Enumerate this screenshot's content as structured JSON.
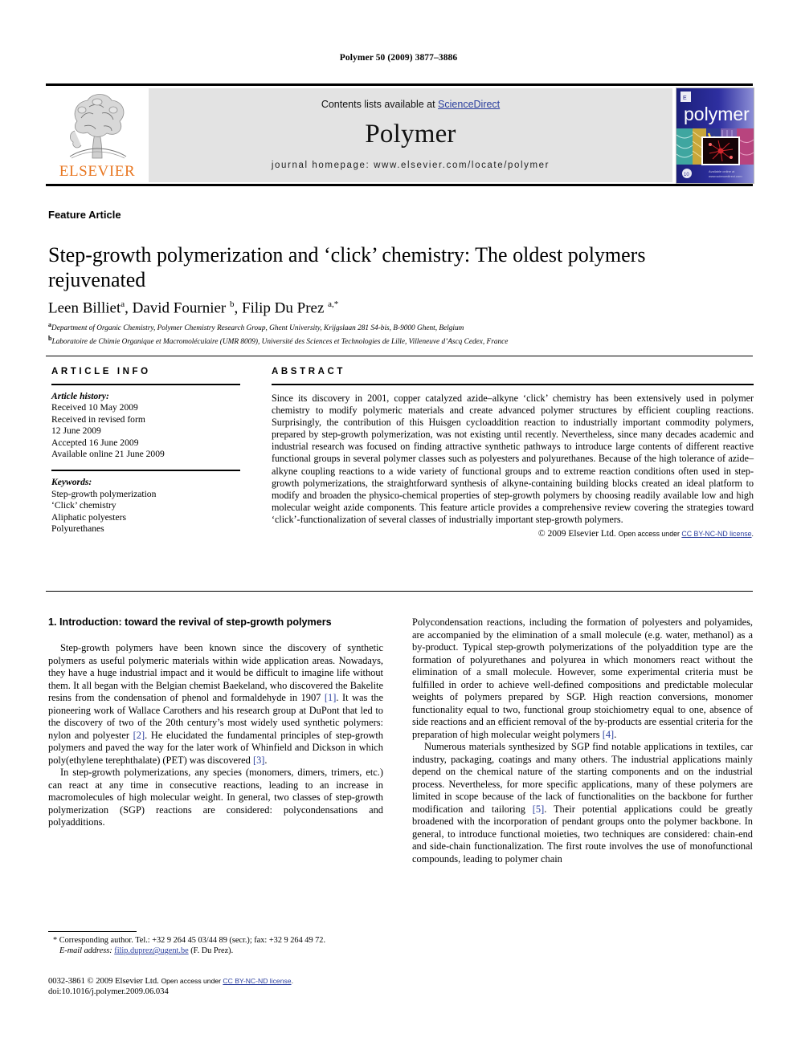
{
  "running_head": "Polymer 50 (2009) 3877–3886",
  "masthead": {
    "contents_prefix": "Contents lists available at ",
    "sciencedirect": "ScienceDirect",
    "journal_name": "Polymer",
    "homepage": "journal homepage: www.elsevier.com/locate/polymer",
    "publisher_logo_text": "ELSEVIER",
    "cover_title": "polymer"
  },
  "article": {
    "type_label": "Feature Article",
    "title": "Step-growth polymerization and ‘click’ chemistry: The oldest polymers rejuvenated",
    "authors_html": "Leen Billiet<sup>a</sup>, David Fournier <sup>b</sup>, Filip Du Prez <sup>a,</sup><sup>*</sup>",
    "affiliations": [
      "Department of Organic Chemistry, Polymer Chemistry Research Group, Ghent University, Krijgslaan 281 S4-bis, B-9000 Ghent, Belgium",
      "Laboratoire de Chimie Organique et Macromoléculaire (UMR 8009), Université des Sciences et Technologies de Lille, Villeneuve d’Ascq Cedex, France"
    ],
    "affiliation_marks": [
      "a",
      "b"
    ]
  },
  "info": {
    "heading": "ARTICLE INFO",
    "history_label": "Article history:",
    "history_lines": [
      "Received 10 May 2009",
      "Received in revised form",
      "12 June 2009",
      "Accepted 16 June 2009",
      "Available online 21 June 2009"
    ],
    "keywords_label": "Keywords:",
    "keywords": [
      "Step-growth polymerization",
      "‘Click’ chemistry",
      "Aliphatic polyesters",
      "Polyurethanes"
    ]
  },
  "abstract": {
    "heading": "ABSTRACT",
    "text": "Since its discovery in 2001, copper catalyzed azide–alkyne ‘click’ chemistry has been extensively used in polymer chemistry to modify polymeric materials and create advanced polymer structures by efficient coupling reactions. Surprisingly, the contribution of this Huisgen cycloaddition reaction to industrially important commodity polymers, prepared by step-growth polymerization, was not existing until recently. Nevertheless, since many decades academic and industrial research was focused on finding attractive synthetic pathways to introduce large contents of different reactive functional groups in several polymer classes such as polyesters and polyurethanes. Because of the high tolerance of azide–alkyne coupling reactions to a wide variety of functional groups and to extreme reaction conditions often used in step-growth polymerizations, the straightforward synthesis of alkyne-containing building blocks created an ideal platform to modify and broaden the physico-chemical properties of step-growth polymers by choosing readily available low and high molecular weight azide components. This feature article provides a comprehensive review covering the strategies toward ‘click’-functionalization of several classes of industrially important step-growth polymers.",
    "copyright": "© 2009 Elsevier Ltd.",
    "open_access_text": "Open access under ",
    "license_link": "CC BY-NC-ND license",
    "license_suffix": "."
  },
  "body": {
    "section_heading": "1. Introduction: toward the revival of step-growth polymers",
    "left_paragraphs": [
      "Step-growth polymers have been known since the discovery of synthetic polymers as useful polymeric materials within wide application areas. Nowadays, they have a huge industrial impact and it would be difficult to imagine life without them. It all began with the Belgian chemist Baekeland, who discovered the Bakelite resins from the condensation of phenol and formaldehyde in 1907 [1]. It was the pioneering work of Wallace Carothers and his research group at DuPont that led to the discovery of two of the 20th century’s most widely used synthetic polymers: nylon and polyester [2]. He elucidated the fundamental principles of step-growth polymers and paved the way for the later work of Whinfield and Dickson in which poly(ethylene terephthalate) (PET) was discovered [3].",
      "In step-growth polymerizations, any species (monomers, dimers, trimers, etc.) can react at any time in consecutive reactions, leading to an increase in macromolecules of high molecular weight. In general, two classes of step-growth polymerization (SGP) reactions are considered: polycondensations and polyadditions."
    ],
    "right_paragraphs": [
      "Polycondensation reactions, including the formation of polyesters and polyamides, are accompanied by the elimination of a small molecule (e.g. water, methanol) as a by-product. Typical step-growth polymerizations of the polyaddition type are the formation of polyurethanes and polyurea in which monomers react without the elimination of a small molecule. However, some experimental criteria must be fulfilled in order to achieve well-defined compositions and predictable molecular weights of polymers prepared by SGP. High reaction conversions, monomer functionality equal to two, functional group stoichiometry equal to one, absence of side reactions and an efficient removal of the by-products are essential criteria for the preparation of high molecular weight polymers [4].",
      "Numerous materials synthesized by SGP find notable applications in textiles, car industry, packaging, coatings and many others. The industrial applications mainly depend on the chemical nature of the starting components and on the industrial process. Nevertheless, for more specific applications, many of these polymers are limited in scope because of the lack of functionalities on the backbone for further modification and tailoring [5]. Their potential applications could be greatly broadened with the incorporation of pendant groups onto the polymer backbone. In general, to introduce functional moieties, two techniques are considered: chain-end and side-chain functionalization. The first route involves the use of monofunctional compounds, leading to polymer chain"
    ]
  },
  "footer": {
    "corresponding_star": "*",
    "corresponding": "Corresponding author. Tel.: +32 9 264 45 03/44 89 (secr.); fax: +32 9 264 49 72.",
    "email_label": "E-mail address:",
    "email": "filip.duprez@ugent.be",
    "email_person": "(F. Du Prez).",
    "issn_line": "0032-3861 © 2009 Elsevier Ltd.",
    "issn_open_access": "Open access under ",
    "issn_license": "CC BY-NC-ND license",
    "issn_license_suffix": ".",
    "doi": "doi:10.1016/j.polymer.2009.06.034"
  },
  "colors": {
    "link": "#2b3f9e",
    "elsevier_orange": "#E87722",
    "masthead_bg": "#e3e3e3"
  }
}
